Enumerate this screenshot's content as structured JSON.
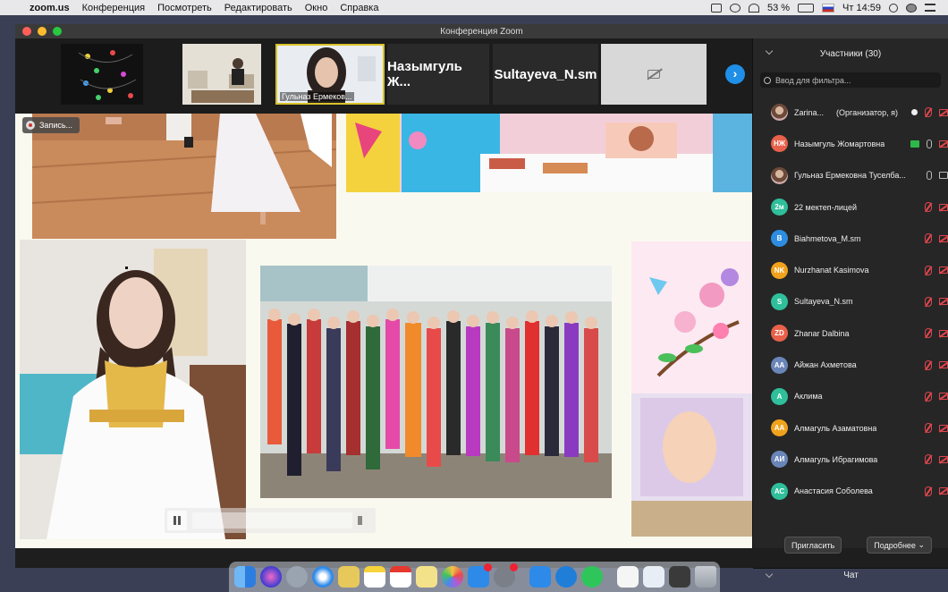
{
  "menubar": {
    "app": "zoom.us",
    "items": [
      "Конференция",
      "Посмотреть",
      "Редактировать",
      "Окно",
      "Справка"
    ],
    "battery": "53 %",
    "clock": "Чт 14:59"
  },
  "window": {
    "title": "Конференция Zoom"
  },
  "thumbnails": [
    {
      "label": ""
    },
    {
      "label": ""
    },
    {
      "label": "Гульназ Ермеков..."
    },
    {
      "label": "Назымгуль Ж..."
    },
    {
      "label": "Sultayeva_N.sm"
    },
    {
      "label": ""
    }
  ],
  "recording": {
    "label": "Запись..."
  },
  "participants_panel": {
    "title": "Участники (30)",
    "filter_placeholder": "Ввод для фильтра...",
    "participants": [
      {
        "initials": "",
        "name": "Zarina...",
        "role": "(Организатор, я)",
        "color": "#333333"
      },
      {
        "initials": "НЖ",
        "name": "Назымгуль Жомартовна",
        "role": "",
        "color": "#e8614a"
      },
      {
        "initials": "",
        "name": "Гульназ Ермековна Туселба...",
        "role": "",
        "color": "#8a6a5a"
      },
      {
        "initials": "2м",
        "name": "22 мектеп-лицей",
        "role": "",
        "color": "#2fbf9b"
      },
      {
        "initials": "B",
        "name": "Biahmetova_M.sm",
        "role": "",
        "color": "#2e8de0"
      },
      {
        "initials": "NK",
        "name": "Nurzhanat Kasimova",
        "role": "",
        "color": "#f0a21c"
      },
      {
        "initials": "S",
        "name": "Sultayeva_N.sm",
        "role": "",
        "color": "#2fbf9b"
      },
      {
        "initials": "ZD",
        "name": "Zhanar Dalbina",
        "role": "",
        "color": "#e8614a"
      },
      {
        "initials": "AA",
        "name": "Айжан Ахметова",
        "role": "",
        "color": "#6a86b8"
      },
      {
        "initials": "A",
        "name": "Аклима",
        "role": "",
        "color": "#2fbf9b"
      },
      {
        "initials": "AA",
        "name": "Алмагуль Азаматовна",
        "role": "",
        "color": "#f0a21c"
      },
      {
        "initials": "АИ",
        "name": "Алмагуль Ибрагимова",
        "role": "",
        "color": "#6a86b8"
      },
      {
        "initials": "АС",
        "name": "Анастасия Соболева",
        "role": "",
        "color": "#2fbf9b"
      }
    ],
    "invite_label": "Пригласить",
    "more_label": "Подробнее"
  },
  "chat": {
    "title": "Чат"
  },
  "icons": {
    "apple": "apple-logo-icon",
    "wifi": "wifi-icon",
    "search": "search-icon",
    "mic_muted": "mic-muted-icon",
    "video_off": "video-off-icon"
  },
  "colors": {
    "accent": "#1f8fe8",
    "muted_red": "#e0464e",
    "active_border": "#d8c22a"
  }
}
